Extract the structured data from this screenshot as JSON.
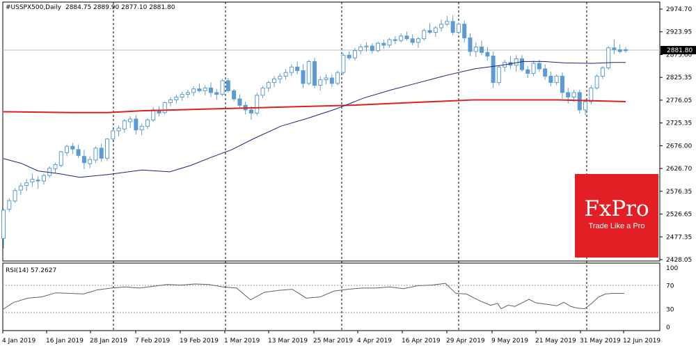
{
  "header": {
    "symbol": "#USSPX500,Daily",
    "ohlc": "2884.75 2889.90 2877.10 2881.80"
  },
  "price_axis": {
    "ticks": [
      "2974.70",
      "2923.95",
      "2875.60",
      "2825.35",
      "2776.05",
      "2725.35",
      "2676.00",
      "2626.70",
      "2576.35",
      "2526.65",
      "2477.35",
      "2428.05"
    ],
    "current_price": "2881.80"
  },
  "rsi_panel": {
    "label": "RSI(14) 57.2627",
    "ticks": [
      "100",
      "70",
      "30",
      "0"
    ]
  },
  "time_axis": {
    "labels": [
      "4 Jan 2019",
      "16 Jan 2019",
      "28 Jan 2019",
      "7 Feb 2019",
      "19 Feb 2019",
      "1 Mar 2019",
      "13 Mar 2019",
      "25 Mar 2019",
      "4 Apr 2019",
      "16 Apr 2019",
      "29 Apr 2019",
      "9 May 2019",
      "21 May 2019",
      "31 May 2019",
      "12 Jun 2019"
    ]
  },
  "brand": {
    "name": "FxPro",
    "tagline": "Trade Like a Pro"
  },
  "colors": {
    "candle": "#5b9bd5",
    "ma_fast": "#1a237e",
    "ma_slow": "#e02020",
    "brand": "#e31e24"
  },
  "chart_data": {
    "type": "candlestick",
    "ylim": [
      2420,
      2990
    ],
    "candles": [
      [
        2470,
        2535,
        2448,
        2532
      ],
      [
        2534,
        2558,
        2528,
        2553
      ],
      [
        2552,
        2580,
        2548,
        2575
      ],
      [
        2576,
        2592,
        2565,
        2585
      ],
      [
        2586,
        2600,
        2574,
        2592
      ],
      [
        2594,
        2612,
        2583,
        2600
      ],
      [
        2598,
        2606,
        2580,
        2596
      ],
      [
        2596,
        2612,
        2588,
        2608
      ],
      [
        2608,
        2628,
        2603,
        2624
      ],
      [
        2623,
        2636,
        2614,
        2632
      ],
      [
        2630,
        2662,
        2626,
        2660
      ],
      [
        2658,
        2676,
        2650,
        2672
      ],
      [
        2672,
        2680,
        2655,
        2666
      ],
      [
        2665,
        2676,
        2646,
        2652
      ],
      [
        2650,
        2664,
        2622,
        2636
      ],
      [
        2634,
        2650,
        2624,
        2643
      ],
      [
        2642,
        2672,
        2636,
        2668
      ],
      [
        2668,
        2678,
        2638,
        2646
      ],
      [
        2646,
        2690,
        2640,
        2688
      ],
      [
        2688,
        2712,
        2682,
        2706
      ],
      [
        2706,
        2718,
        2694,
        2712
      ],
      [
        2710,
        2732,
        2702,
        2728
      ],
      [
        2726,
        2738,
        2712,
        2732
      ],
      [
        2732,
        2740,
        2698,
        2708
      ],
      [
        2708,
        2722,
        2696,
        2716
      ],
      [
        2716,
        2734,
        2710,
        2730
      ],
      [
        2730,
        2758,
        2726,
        2752
      ],
      [
        2750,
        2760,
        2738,
        2745
      ],
      [
        2746,
        2770,
        2742,
        2768
      ],
      [
        2768,
        2780,
        2760,
        2774
      ],
      [
        2774,
        2786,
        2766,
        2780
      ],
      [
        2780,
        2792,
        2772,
        2786
      ],
      [
        2786,
        2796,
        2778,
        2790
      ],
      [
        2790,
        2804,
        2782,
        2798
      ],
      [
        2798,
        2810,
        2790,
        2794
      ],
      [
        2794,
        2806,
        2784,
        2800
      ],
      [
        2800,
        2812,
        2780,
        2790
      ],
      [
        2790,
        2798,
        2774,
        2786
      ],
      [
        2786,
        2820,
        2782,
        2816
      ],
      [
        2816,
        2822,
        2790,
        2794
      ],
      [
        2794,
        2798,
        2770,
        2776
      ],
      [
        2776,
        2786,
        2756,
        2762
      ],
      [
        2762,
        2770,
        2742,
        2752
      ],
      [
        2752,
        2760,
        2730,
        2745
      ],
      [
        2745,
        2790,
        2740,
        2784
      ],
      [
        2784,
        2804,
        2778,
        2800
      ],
      [
        2800,
        2816,
        2792,
        2812
      ],
      [
        2812,
        2826,
        2802,
        2820
      ],
      [
        2820,
        2832,
        2810,
        2826
      ],
      [
        2826,
        2842,
        2818,
        2834
      ],
      [
        2834,
        2852,
        2826,
        2846
      ],
      [
        2846,
        2858,
        2830,
        2838
      ],
      [
        2838,
        2852,
        2800,
        2810
      ],
      [
        2810,
        2862,
        2806,
        2858
      ],
      [
        2858,
        2866,
        2800,
        2806
      ],
      [
        2806,
        2826,
        2794,
        2818
      ],
      [
        2818,
        2830,
        2808,
        2822
      ],
      [
        2822,
        2830,
        2802,
        2810
      ],
      [
        2810,
        2838,
        2806,
        2834
      ],
      [
        2834,
        2876,
        2830,
        2872
      ],
      [
        2872,
        2880,
        2862,
        2866
      ],
      [
        2866,
        2888,
        2860,
        2882
      ],
      [
        2882,
        2896,
        2874,
        2890
      ],
      [
        2890,
        2900,
        2880,
        2892
      ],
      [
        2892,
        2898,
        2876,
        2882
      ],
      [
        2882,
        2902,
        2878,
        2898
      ],
      [
        2898,
        2906,
        2886,
        2894
      ],
      [
        2894,
        2910,
        2888,
        2906
      ],
      [
        2906,
        2914,
        2896,
        2904
      ],
      [
        2904,
        2920,
        2900,
        2914
      ],
      [
        2914,
        2924,
        2904,
        2908
      ],
      [
        2908,
        2918,
        2894,
        2900
      ],
      [
        2900,
        2912,
        2888,
        2908
      ],
      [
        2908,
        2930,
        2904,
        2926
      ],
      [
        2926,
        2942,
        2918,
        2922
      ],
      [
        2922,
        2936,
        2912,
        2932
      ],
      [
        2932,
        2950,
        2924,
        2940
      ],
      [
        2940,
        2958,
        2936,
        2946
      ],
      [
        2946,
        2960,
        2916,
        2922
      ],
      [
        2922,
        2944,
        2918,
        2940
      ],
      [
        2940,
        2948,
        2900,
        2910
      ],
      [
        2910,
        2920,
        2870,
        2880
      ],
      [
        2880,
        2900,
        2868,
        2890
      ],
      [
        2890,
        2904,
        2872,
        2878
      ],
      [
        2878,
        2890,
        2860,
        2870
      ],
      [
        2870,
        2880,
        2800,
        2812
      ],
      [
        2812,
        2850,
        2806,
        2846
      ],
      [
        2846,
        2862,
        2836,
        2856
      ],
      [
        2856,
        2870,
        2842,
        2850
      ],
      [
        2850,
        2872,
        2836,
        2864
      ],
      [
        2864,
        2872,
        2836,
        2840
      ],
      [
        2840,
        2848,
        2822,
        2832
      ],
      [
        2832,
        2860,
        2826,
        2854
      ],
      [
        2854,
        2862,
        2836,
        2842
      ],
      [
        2842,
        2852,
        2818,
        2826
      ],
      [
        2826,
        2836,
        2804,
        2812
      ],
      [
        2812,
        2830,
        2806,
        2826
      ],
      [
        2826,
        2834,
        2776,
        2790
      ],
      [
        2790,
        2800,
        2766,
        2780
      ],
      [
        2780,
        2796,
        2770,
        2790
      ],
      [
        2790,
        2796,
        2744,
        2752
      ],
      [
        2752,
        2776,
        2740,
        2770
      ],
      [
        2770,
        2806,
        2764,
        2800
      ],
      [
        2800,
        2830,
        2796,
        2826
      ],
      [
        2826,
        2848,
        2820,
        2844
      ],
      [
        2844,
        2892,
        2840,
        2888
      ],
      [
        2888,
        2906,
        2874,
        2884
      ],
      [
        2884,
        2896,
        2876,
        2880
      ],
      [
        2884,
        2890,
        2877,
        2882
      ]
    ],
    "ma_fast": [
      [
        0,
        2645
      ],
      [
        25,
        2635
      ],
      [
        50,
        2618
      ],
      [
        80,
        2612
      ],
      [
        110,
        2604
      ],
      [
        150,
        2610
      ],
      [
        200,
        2620
      ],
      [
        240,
        2616
      ],
      [
        270,
        2630
      ],
      [
        300,
        2648
      ],
      [
        330,
        2665
      ],
      [
        360,
        2688
      ],
      [
        400,
        2716
      ],
      [
        440,
        2734
      ],
      [
        480,
        2754
      ],
      [
        520,
        2778
      ],
      [
        560,
        2796
      ],
      [
        600,
        2812
      ],
      [
        640,
        2828
      ],
      [
        680,
        2842
      ],
      [
        720,
        2850
      ],
      [
        750,
        2858
      ],
      [
        780,
        2858
      ],
      [
        810,
        2855
      ],
      [
        850,
        2854
      ],
      [
        880,
        2856
      ],
      [
        898,
        2856
      ]
    ],
    "ma_slow": [
      [
        0,
        2748
      ],
      [
        100,
        2746
      ],
      [
        150,
        2746
      ],
      [
        200,
        2750
      ],
      [
        300,
        2754
      ],
      [
        400,
        2758
      ],
      [
        500,
        2762
      ],
      [
        560,
        2766
      ],
      [
        620,
        2770
      ],
      [
        680,
        2774
      ],
      [
        750,
        2774
      ],
      [
        800,
        2774
      ],
      [
        850,
        2772
      ],
      [
        898,
        2770
      ]
    ],
    "rsi": [
      [
        4,
        30
      ],
      [
        20,
        42
      ],
      [
        40,
        49
      ],
      [
        60,
        51
      ],
      [
        80,
        58
      ],
      [
        100,
        57
      ],
      [
        120,
        56
      ],
      [
        140,
        63
      ],
      [
        160,
        66
      ],
      [
        180,
        68
      ],
      [
        200,
        66
      ],
      [
        220,
        69
      ],
      [
        240,
        72
      ],
      [
        260,
        71
      ],
      [
        280,
        73
      ],
      [
        300,
        72
      ],
      [
        320,
        68
      ],
      [
        340,
        66
      ],
      [
        360,
        46
      ],
      [
        380,
        59
      ],
      [
        400,
        62
      ],
      [
        420,
        64
      ],
      [
        440,
        49
      ],
      [
        460,
        51
      ],
      [
        480,
        61
      ],
      [
        500,
        64
      ],
      [
        520,
        66
      ],
      [
        540,
        66
      ],
      [
        560,
        68
      ],
      [
        580,
        65
      ],
      [
        600,
        70
      ],
      [
        620,
        71
      ],
      [
        640,
        74
      ],
      [
        655,
        57
      ],
      [
        670,
        56
      ],
      [
        690,
        44
      ],
      [
        705,
        37
      ],
      [
        715,
        40
      ],
      [
        720,
        31
      ],
      [
        730,
        37
      ],
      [
        740,
        35
      ],
      [
        760,
        47
      ],
      [
        770,
        41
      ],
      [
        790,
        38
      ],
      [
        800,
        36
      ],
      [
        810,
        42
      ],
      [
        820,
        35
      ],
      [
        830,
        32
      ],
      [
        840,
        31
      ],
      [
        850,
        40
      ],
      [
        860,
        51
      ],
      [
        870,
        56
      ],
      [
        880,
        57
      ],
      [
        897,
        57
      ]
    ]
  }
}
